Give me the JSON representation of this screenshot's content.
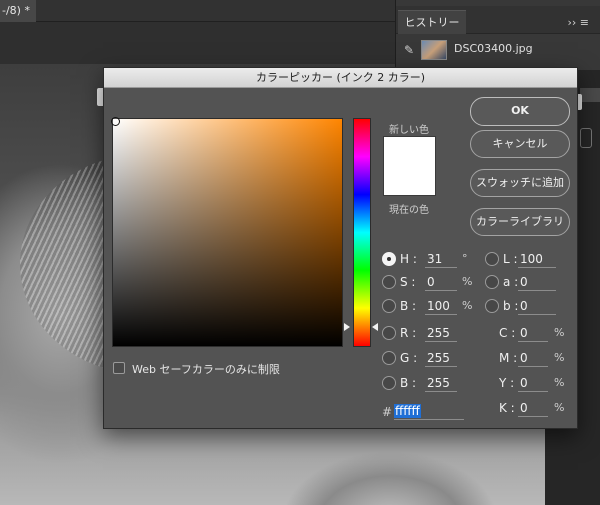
{
  "document": {
    "tab_title": "-/8) *"
  },
  "history": {
    "tab_label": "ヒストリー",
    "menu_glyph": "›› ≡",
    "item_label": "DSC03400.jpg"
  },
  "dialog": {
    "title": "カラーピッカー (インク 2 カラー)",
    "new_label": "新しい色",
    "current_label": "現在の色",
    "new_color": "#ffffff",
    "buttons": {
      "ok": "OK",
      "cancel": "キャンセル",
      "add_swatch": "スウォッチに追加",
      "color_library": "カラーライブラリ"
    },
    "hsb": {
      "h": {
        "label": "H :",
        "value": "31",
        "unit": "°"
      },
      "s": {
        "label": "S :",
        "value": "0",
        "unit": "%"
      },
      "b": {
        "label": "B :",
        "value": "100",
        "unit": "%"
      }
    },
    "rgb": {
      "r": {
        "label": "R :",
        "value": "255"
      },
      "g": {
        "label": "G :",
        "value": "255"
      },
      "b": {
        "label": "B :",
        "value": "255"
      }
    },
    "lab": {
      "l": {
        "label": "L :",
        "value": "100"
      },
      "a": {
        "label": "a :",
        "value": "0"
      },
      "b": {
        "label": "b :",
        "value": "0"
      }
    },
    "cmyk": {
      "c": {
        "label": "C :",
        "value": "0",
        "unit": "%"
      },
      "m": {
        "label": "M :",
        "value": "0",
        "unit": "%"
      },
      "y": {
        "label": "Y :",
        "value": "0",
        "unit": "%"
      },
      "k": {
        "label": "K :",
        "value": "0",
        "unit": "%"
      }
    },
    "hex_hash": "#",
    "hex_value": "ffffff",
    "web_safe_label": "Web セーフカラーのみに制限"
  }
}
